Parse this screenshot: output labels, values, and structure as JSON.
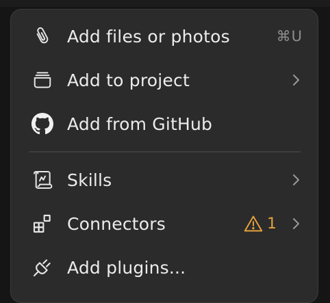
{
  "menu": {
    "items": [
      {
        "label": "Add files or photos",
        "icon": "paperclip-icon",
        "shortcut": "⌘U"
      },
      {
        "label": "Add to project",
        "icon": "project-box-icon",
        "has_submenu": true
      },
      {
        "label": "Add from GitHub",
        "icon": "github-icon"
      },
      {
        "label": "Skills",
        "icon": "scroll-icon",
        "has_submenu": true
      },
      {
        "label": "Connectors",
        "icon": "connectors-icon",
        "has_submenu": true,
        "warning_count": "1"
      },
      {
        "label": "Add plugins...",
        "icon": "plug-icon"
      }
    ]
  },
  "colors": {
    "menu_background": "#2b2b2b",
    "text": "#ececec",
    "muted": "#8e8e8e",
    "warning": "#e6a23c"
  }
}
